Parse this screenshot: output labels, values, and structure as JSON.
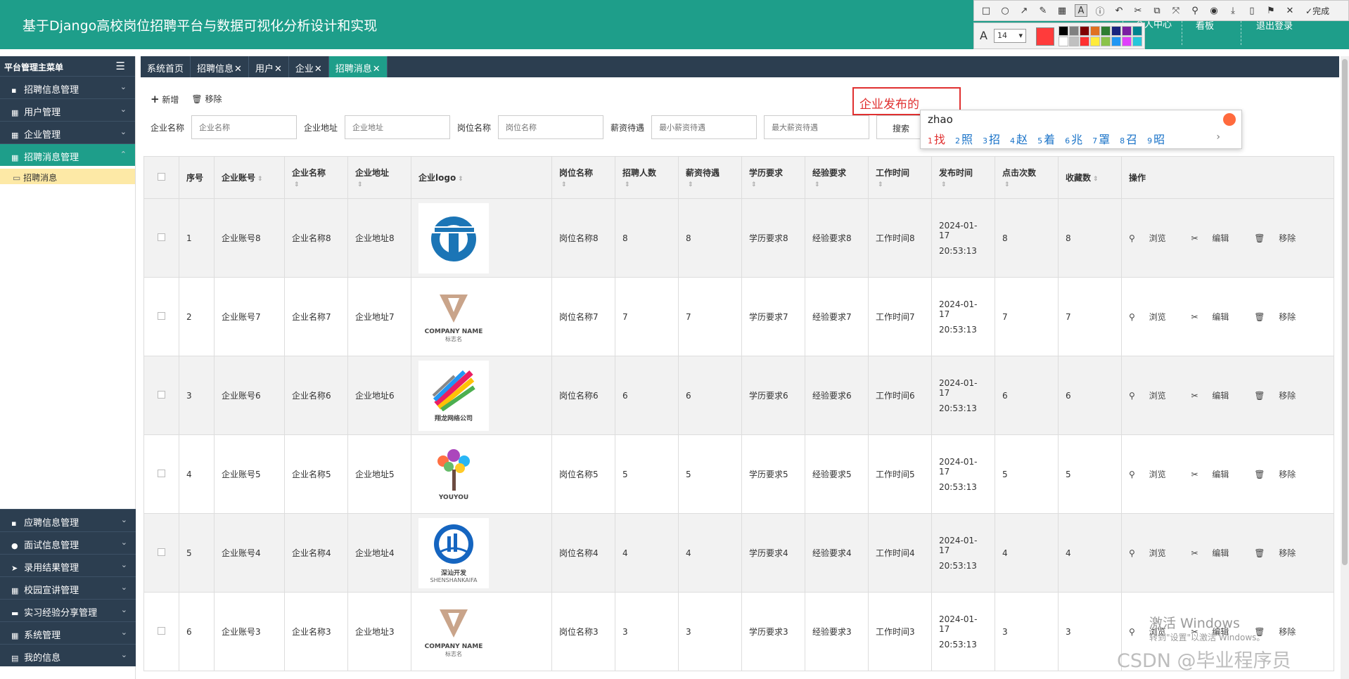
{
  "header": {
    "title": "基于Django高校岗位招聘平台与数据可视化分析设计和实现",
    "nav": [
      "个人中心",
      "看板",
      "退出登录"
    ]
  },
  "screenshot_tool": {
    "done_label": "完成",
    "font_size": "14"
  },
  "sidebar": {
    "head": "平台管理主菜单",
    "items": [
      {
        "label": "招聘信息管理",
        "icon": "briefcase-icon"
      },
      {
        "label": "用户管理",
        "icon": "grid-icon"
      },
      {
        "label": "企业管理",
        "icon": "grid-icon"
      },
      {
        "label": "招聘消息管理",
        "icon": "grid-icon"
      }
    ],
    "sub_item": "招聘消息",
    "bottom_items": [
      {
        "label": "应聘信息管理",
        "icon": "briefcase-icon"
      },
      {
        "label": "面试信息管理",
        "icon": "user-icon"
      },
      {
        "label": "录用结果管理",
        "icon": "send-icon"
      },
      {
        "label": "校园宣讲管理",
        "icon": "grid-icon"
      },
      {
        "label": "实习经验分享管理",
        "icon": "comment-icon"
      },
      {
        "label": "系统管理",
        "icon": "grid-icon"
      },
      {
        "label": "我的信息",
        "icon": "card-icon"
      }
    ]
  },
  "tabs": [
    "系统首页",
    "招聘信息",
    "用户",
    "企业",
    "招聘消息"
  ],
  "toolbar": {
    "add": "新增",
    "remove": "移除"
  },
  "filters": {
    "company_name_label": "企业名称",
    "company_name_ph": "企业名称",
    "company_addr_label": "企业地址",
    "company_addr_ph": "企业地址",
    "job_label": "岗位名称",
    "job_ph": "岗位名称",
    "salary_label": "薪资待遇",
    "salary_min_ph": "最小薪资待遇",
    "salary_max_ph": "最大薪资待遇",
    "search": "搜索"
  },
  "annotation": "企业发布的",
  "ime": {
    "pinyin": "zhao",
    "candidates": [
      "找",
      "照",
      "招",
      "赵",
      "着",
      "兆",
      "罩",
      "召",
      "昭"
    ]
  },
  "table": {
    "headers": [
      "序号",
      "企业账号",
      "企业名称",
      "企业地址",
      "企业logo",
      "岗位名称",
      "招聘人数",
      "薪资待遇",
      "学历要求",
      "经验要求",
      "工作时间",
      "发布时间",
      "点击次数",
      "收藏数",
      "操作"
    ],
    "ops": [
      "浏览",
      "编辑",
      "移除"
    ],
    "rows": [
      {
        "no": "1",
        "account": "企业账号8",
        "name": "企业名称8",
        "addr": "企业地址8",
        "logo": "T",
        "job": "岗位名称8",
        "count": "8",
        "salary": "8",
        "edu": "学历要求8",
        "exp": "经验要求8",
        "worktime": "工作时间8",
        "date": "2024-01-17",
        "time": "20:53:13",
        "clicks": "8",
        "favs": "8"
      },
      {
        "no": "2",
        "account": "企业账号7",
        "name": "企业名称7",
        "addr": "企业地址7",
        "logo": "COMPANY NAME",
        "logo_sub": "标志名",
        "job": "岗位名称7",
        "count": "7",
        "salary": "7",
        "edu": "学历要求7",
        "exp": "经验要求7",
        "worktime": "工作时间7",
        "date": "2024-01-17",
        "time": "20:53:13",
        "clicks": "7",
        "favs": "7"
      },
      {
        "no": "3",
        "account": "企业账号6",
        "name": "企业名称6",
        "addr": "企业地址6",
        "logo": "翔龙网络公司",
        "job": "岗位名称6",
        "count": "6",
        "salary": "6",
        "edu": "学历要求6",
        "exp": "经验要求6",
        "worktime": "工作时间6",
        "date": "2024-01-17",
        "time": "20:53:13",
        "clicks": "6",
        "favs": "6"
      },
      {
        "no": "4",
        "account": "企业账号5",
        "name": "企业名称5",
        "addr": "企业地址5",
        "logo": "YOUYOU",
        "job": "岗位名称5",
        "count": "5",
        "salary": "5",
        "edu": "学历要求5",
        "exp": "经验要求5",
        "worktime": "工作时间5",
        "date": "2024-01-17",
        "time": "20:53:13",
        "clicks": "5",
        "favs": "5"
      },
      {
        "no": "5",
        "account": "企业账号4",
        "name": "企业名称4",
        "addr": "企业地址4",
        "logo": "深汕开发",
        "logo_sub": "SHENSHANKAIFA",
        "job": "岗位名称4",
        "count": "4",
        "salary": "4",
        "edu": "学历要求4",
        "exp": "经验要求4",
        "worktime": "工作时间4",
        "date": "2024-01-17",
        "time": "20:53:13",
        "clicks": "4",
        "favs": "4"
      },
      {
        "no": "6",
        "account": "企业账号3",
        "name": "企业名称3",
        "addr": "企业地址3",
        "logo": "COMPANY NAME",
        "logo_sub": "标志名",
        "job": "岗位名称3",
        "count": "3",
        "salary": "3",
        "edu": "学历要求3",
        "exp": "经验要求3",
        "worktime": "工作时间3",
        "date": "2024-01-17",
        "time": "20:53:13",
        "clicks": "3",
        "favs": "3"
      }
    ]
  },
  "watermarks": {
    "win_title": "激活 Windows",
    "win_sub": "转到\"设置\"以激活 Windows。",
    "csdn": "CSDN @毕业程序员"
  },
  "colors": {
    "header": "#1e9e8a",
    "sidebar": "#2c3e50",
    "accent": "#1e9e8a",
    "annotation": "#e03030"
  }
}
